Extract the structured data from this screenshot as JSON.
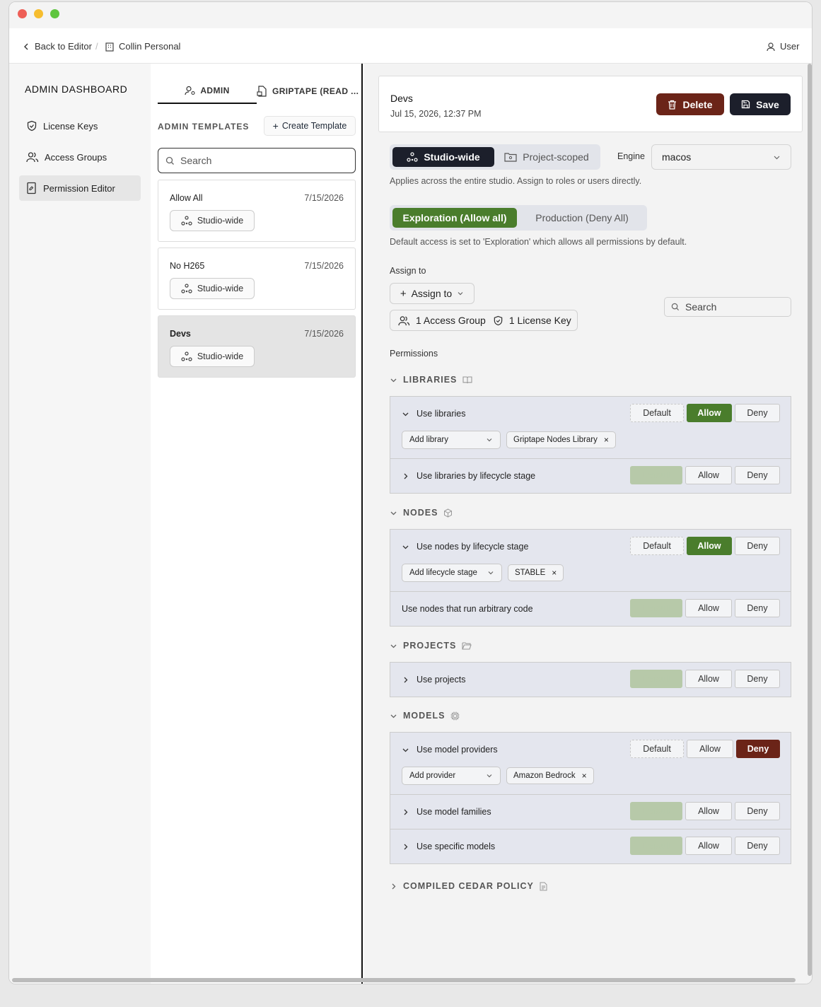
{
  "topbar": {
    "back": "Back to Editor",
    "sep": "/",
    "workspace": "Collin Personal",
    "user": "User"
  },
  "sidebar": {
    "title": "ADMIN DASHBOARD",
    "items": [
      {
        "label": "License Keys"
      },
      {
        "label": "Access Groups"
      },
      {
        "label": "Permission Editor"
      }
    ]
  },
  "middle": {
    "tabs": [
      {
        "label": "ADMIN"
      },
      {
        "label": "GRIPTAPE (READ ..."
      }
    ],
    "heading": "ADMIN TEMPLATES",
    "create_label": "Create Template",
    "search_placeholder": "Search",
    "templates": [
      {
        "name": "Allow All",
        "date": "7/15/2026",
        "scope": "Studio-wide"
      },
      {
        "name": "No H265",
        "date": "7/15/2026",
        "scope": "Studio-wide"
      },
      {
        "name": "Devs",
        "date": "7/15/2026",
        "scope": "Studio-wide"
      }
    ]
  },
  "detail": {
    "title": "Devs",
    "date": "Jul 15, 2026, 12:37 PM",
    "delete_label": "Delete",
    "save_label": "Save",
    "scope": {
      "studio": "Studio-wide",
      "project": "Project-scoped",
      "help": "Applies across the entire studio. Assign to roles or users directly."
    },
    "engine": {
      "label": "Engine",
      "value": "macos"
    },
    "mode": {
      "exploration": "Exploration (Allow all)",
      "production": "Production (Deny All)",
      "help": "Default access is set to 'Exploration' which allows all permissions by default."
    },
    "assign": {
      "label": "Assign to",
      "button": "Assign to",
      "groups": "1 Access Group",
      "keys": "1 License Key",
      "search_placeholder": "Search"
    },
    "permissions_label": "Permissions",
    "buttons": {
      "default": "Default",
      "allow": "Allow",
      "deny": "Deny"
    },
    "sections": {
      "libraries": {
        "title": "LIBRARIES",
        "rows": [
          {
            "label": "Use libraries",
            "add": "Add library",
            "chip": "Griptape Nodes Library"
          },
          {
            "label": "Use libraries by lifecycle stage"
          }
        ]
      },
      "nodes": {
        "title": "NODES",
        "rows": [
          {
            "label": "Use nodes by lifecycle stage",
            "add": "Add lifecycle stage",
            "chip": "STABLE"
          },
          {
            "label": "Use nodes that run arbitrary code"
          }
        ]
      },
      "projects": {
        "title": "PROJECTS",
        "rows": [
          {
            "label": "Use projects"
          }
        ]
      },
      "models": {
        "title": "MODELS",
        "rows": [
          {
            "label": "Use model providers",
            "add": "Add provider",
            "chip": "Amazon Bedrock"
          },
          {
            "label": "Use model families"
          },
          {
            "label": "Use specific models"
          }
        ]
      },
      "cedar": {
        "title": "COMPILED CEDAR POLICY"
      }
    },
    "colors": {
      "allow": "#4a7d2c",
      "deny": "#6b2418",
      "dark": "#1c1f2b"
    }
  }
}
